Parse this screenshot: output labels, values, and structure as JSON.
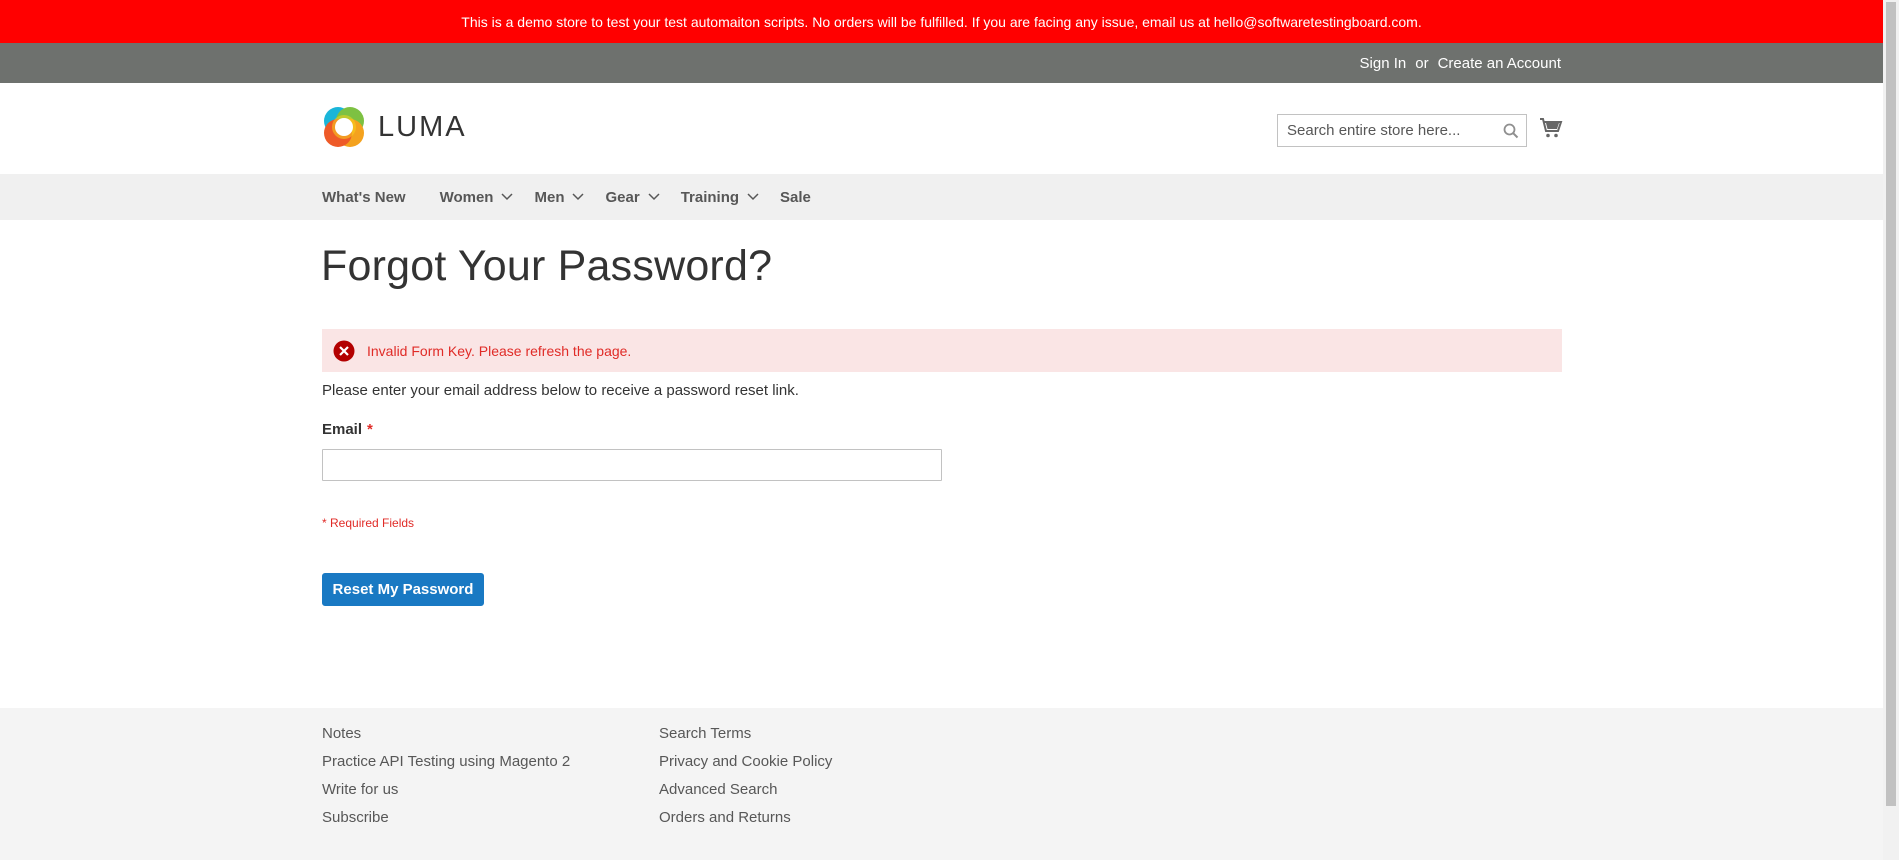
{
  "demo_banner": {
    "text": "This is a demo store to test your test automaiton scripts. No orders will be fulfilled. If you are facing any issue, email us at hello@softwaretestingboard.com."
  },
  "top_links": {
    "sign_in": "Sign In",
    "or": "or",
    "create_account": "Create an Account"
  },
  "header": {
    "logo_text": "LUMA",
    "search_placeholder": "Search entire store here..."
  },
  "nav": {
    "items": [
      {
        "label": "What's New"
      },
      {
        "label": "Women"
      },
      {
        "label": "Men"
      },
      {
        "label": "Gear"
      },
      {
        "label": "Training"
      },
      {
        "label": "Sale"
      }
    ]
  },
  "main": {
    "title": "Forgot Your Password?",
    "error_message": "Invalid Form Key. Please refresh the page.",
    "intro": "Please enter your email address below to receive a password reset link.",
    "email_label": "Email",
    "required_marker": "*",
    "email_value": "",
    "required_note": "* Required Fields",
    "reset_button": "Reset My Password"
  },
  "footer": {
    "col1": [
      "Notes",
      "Practice API Testing using Magento 2",
      "Write for us",
      "Subscribe"
    ],
    "col2": [
      "Search Terms",
      "Privacy and Cookie Policy",
      "Advanced Search",
      "Orders and Returns"
    ]
  },
  "colors": {
    "banner_bg": "#ff0000",
    "top_links_bg": "#6e716e",
    "nav_bg": "#f0f0f0",
    "error_bg": "#fae5e5",
    "error_text": "#e02b27",
    "button_blue": "#1979c3",
    "footer_bg": "#f4f4f4"
  },
  "icons": {
    "search": "search-icon",
    "cart": "cart-icon",
    "error": "error-x-icon",
    "chevron": "chevron-down-icon"
  }
}
